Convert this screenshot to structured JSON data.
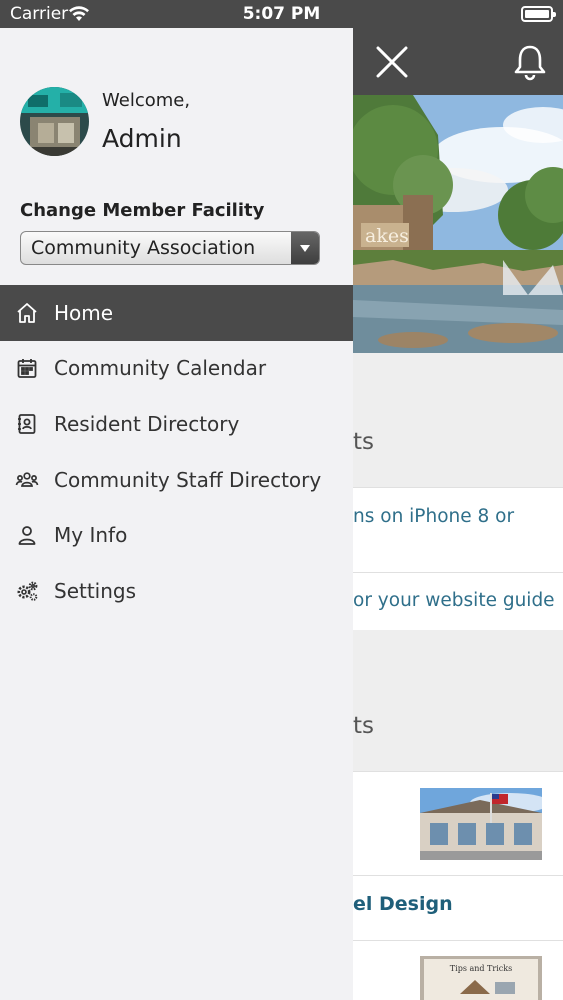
{
  "status_bar": {
    "carrier": "Carrier",
    "time": "5:07 PM"
  },
  "drawer": {
    "welcome": "Welcome,",
    "user_name": "Admin",
    "facility_label": "Change Member Facility",
    "facility_selected": "Community Association",
    "menu": [
      {
        "label": "Home",
        "icon": "home-icon",
        "active": true
      },
      {
        "label": "Community Calendar",
        "icon": "calendar-icon",
        "active": false
      },
      {
        "label": "Resident Directory",
        "icon": "contact-book-icon",
        "active": false
      },
      {
        "label": "Community Staff Directory",
        "icon": "users-icon",
        "active": false
      },
      {
        "label": "My Info",
        "icon": "user-icon",
        "active": false
      },
      {
        "label": "Settings",
        "icon": "gears-icon",
        "active": false
      }
    ]
  },
  "background": {
    "hero_sign_text": "akes",
    "section1_heading_tail": "ts",
    "link1_line": "ns on iPhone 8 or",
    "link2_line": "or your website guide",
    "section2_heading_tail": "ts",
    "article2_title_tail": "el Design",
    "thumb2_caption": "Tips and Tricks"
  },
  "colors": {
    "bar": "#4a4a4a",
    "drawer_bg": "#f2f2f4",
    "link": "#2f6f8a"
  }
}
